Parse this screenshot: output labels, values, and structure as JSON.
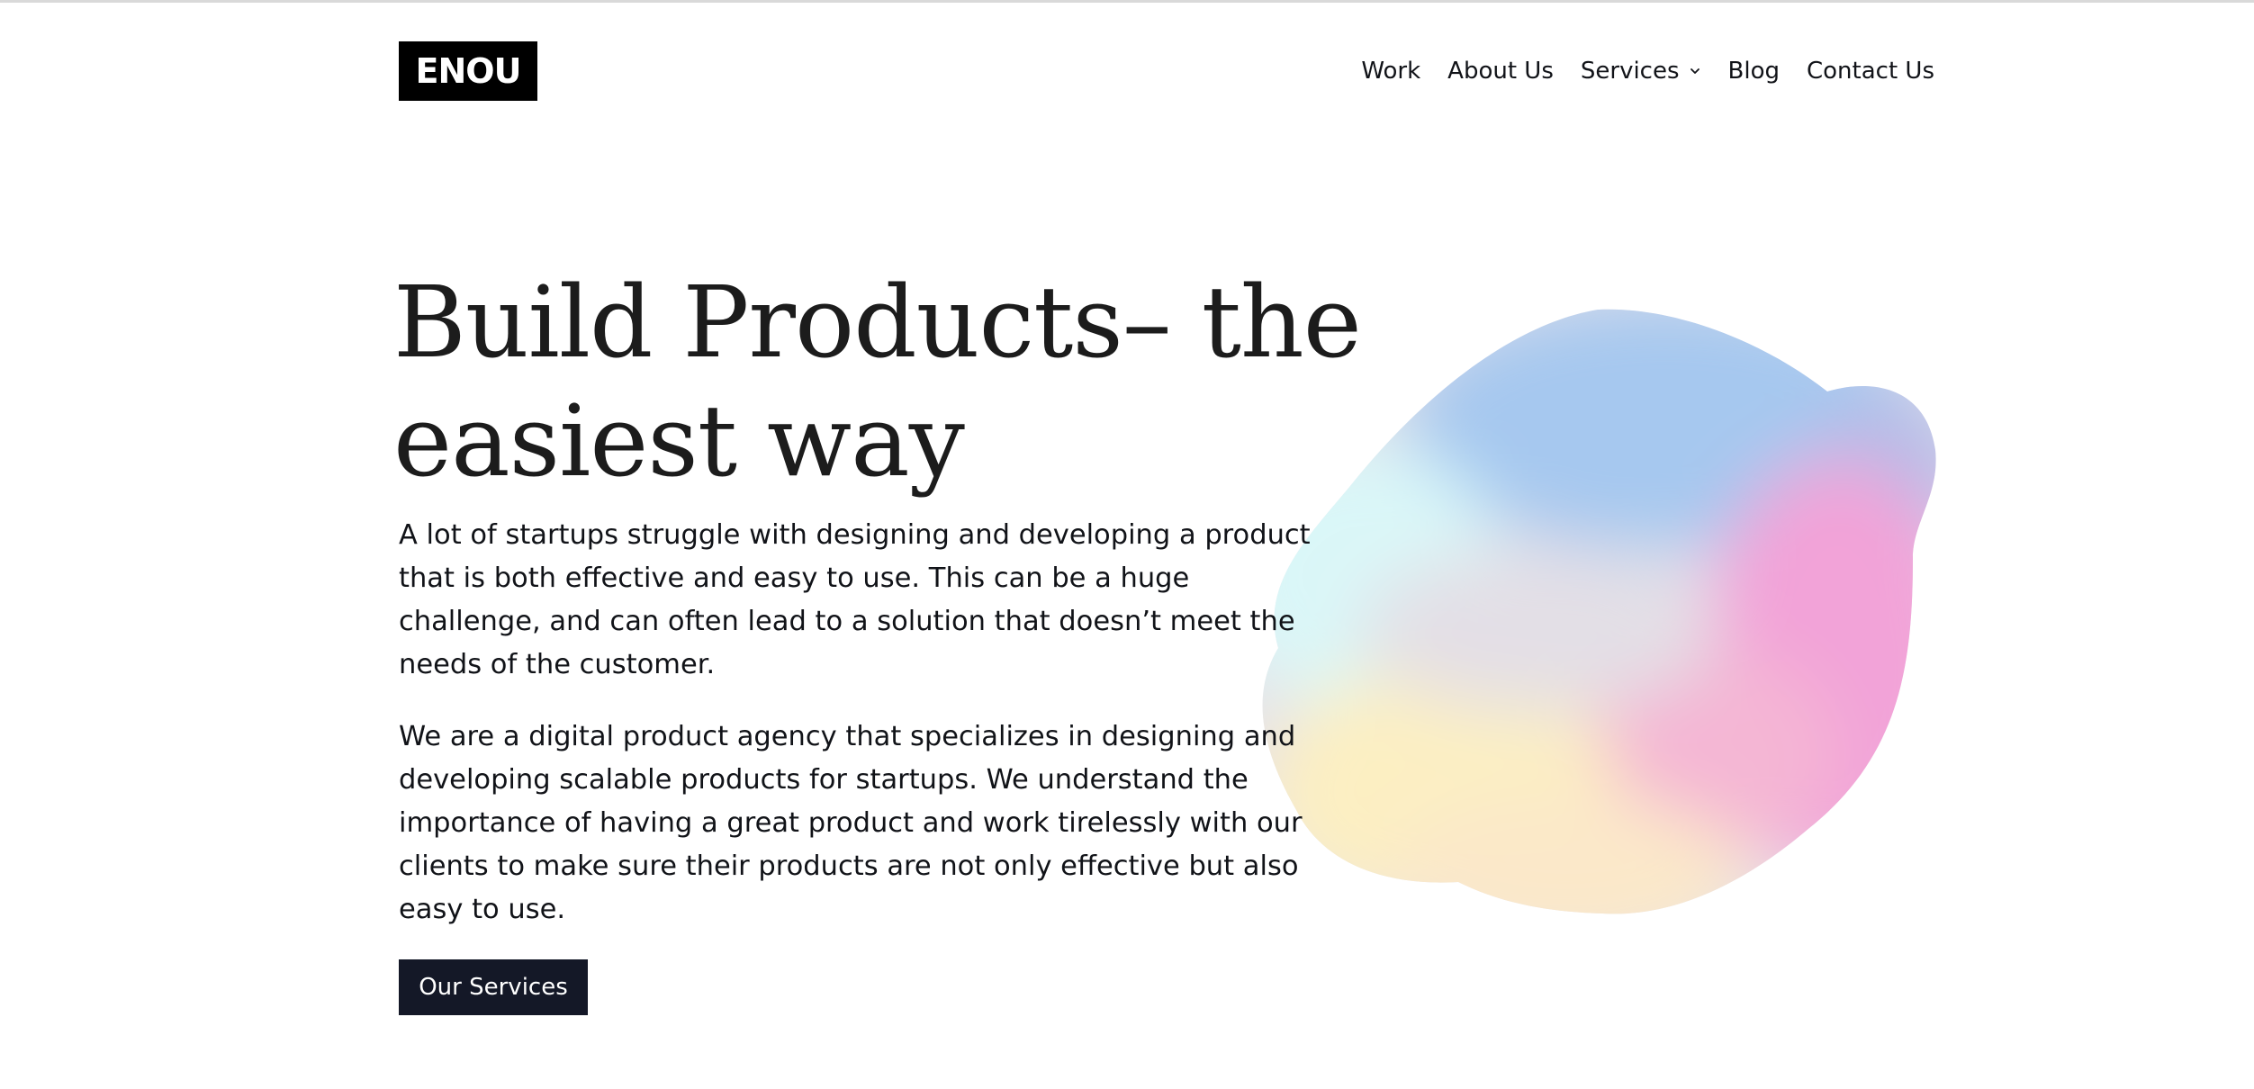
{
  "header": {
    "logo_text": "ENOU",
    "nav": [
      {
        "label": "Work"
      },
      {
        "label": "About Us"
      },
      {
        "label": "Services",
        "has_dropdown": true,
        "icon": "chevron-down-icon"
      },
      {
        "label": "Blog"
      },
      {
        "label": "Contact Us"
      }
    ]
  },
  "hero": {
    "title_line_1": "Build Products– the",
    "title_line_2": "easiest way",
    "paragraph_1": "A lot of startups struggle with designing and developing a product that is both effective and easy to use. This can be a huge challenge, and can often lead to a solution that doesn’t meet the needs of the customer.",
    "paragraph_2": "We are a digital product agency that specializes in designing and developing scalable products for startups. We understand the importance of having a great product and work tirelessly with our clients to make sure their products are not only effective but also easy to use.",
    "cta_label": "Our Services"
  },
  "colors": {
    "logo_bg": "#000000",
    "cta_bg": "#141827",
    "text": "#111318",
    "blob_blue": "#a6c8ef",
    "blob_cyan": "#d9f6f8",
    "blob_pink": "#f2a3d8",
    "blob_yellow": "#fdf0c0",
    "blob_peach": "#f9d3c9"
  }
}
